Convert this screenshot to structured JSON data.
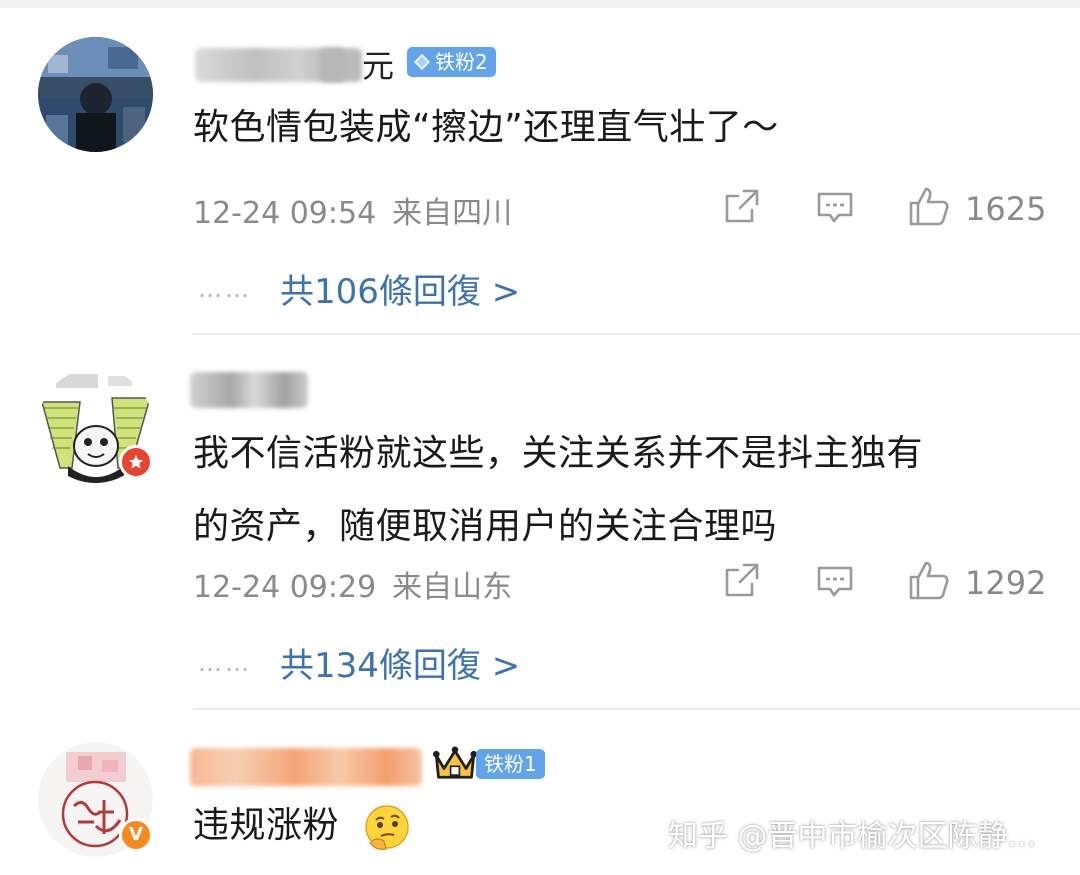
{
  "comments": [
    {
      "name_suffix": "元",
      "badge": "铁粉2",
      "text": "软色情包装成“擦边”还理直气壮了～",
      "time": "12-24 09:54",
      "location": "来自四川",
      "likes": "1625",
      "replies": "共106條回復 >",
      "dots": "……"
    },
    {
      "name_suffix": "",
      "badge": "",
      "text_line1": "我不信活粉就这些，关注关系并不是抖主独有",
      "text_line2": "的资产，随便取消用户的关注合理吗",
      "time": "12-24 09:29",
      "location": "来自山东",
      "likes": "1292",
      "replies": "共134條回復 >",
      "dots": "……"
    },
    {
      "badge": "铁粉1",
      "text": "违规涨粉",
      "verified_mark": "V"
    }
  ],
  "watermark": "知乎 @晋中市榆次区陈静...",
  "colors": {
    "badge_blue": "#62a4ec",
    "link_blue": "#3d73ad",
    "meta_gray": "#8a8a8a",
    "verified_orange": "#f58a1f",
    "verified_red": "#e8432e"
  }
}
